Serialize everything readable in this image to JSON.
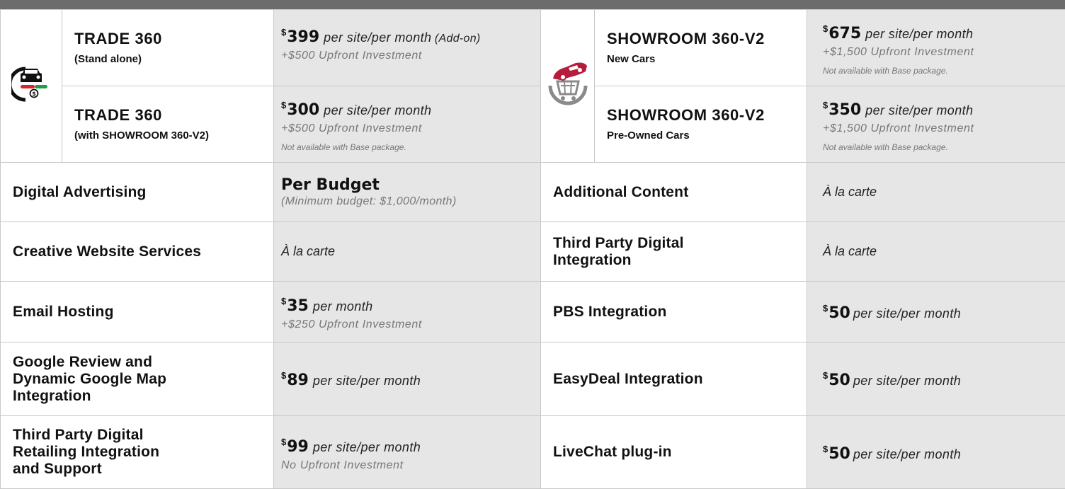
{
  "products": {
    "trade": {
      "icon": "trade-car-icon",
      "rows": [
        {
          "title": "TRADE 360",
          "subtitle": "(Stand alone)",
          "currency": "$",
          "amount": "399",
          "per": "per site/per month",
          "addon": "(Add-on)",
          "upfront": "+$500 Upfront Investment",
          "note": ""
        },
        {
          "title": "TRADE 360",
          "subtitle": "(with SHOWROOM 360-V2)",
          "currency": "$",
          "amount": "300",
          "per": "per site/per month",
          "upfront": "+$500 Upfront Investment",
          "note": "Not available with Base package."
        }
      ]
    },
    "showroom": {
      "icon": "showroom-cart-icon",
      "rows": [
        {
          "title": "SHOWROOM 360-V2",
          "subtitle": "New Cars",
          "currency": "$",
          "amount": "675",
          "per": "per site/per month",
          "upfront": "+$1,500 Upfront Investment",
          "note": "Not available with Base package."
        },
        {
          "title": "SHOWROOM 360-V2",
          "subtitle": "Pre-Owned Cars",
          "currency": "$",
          "amount": "350",
          "per": "per site/per month",
          "upfront": "+$1,500 Upfront Investment",
          "note": "Not available with Base package."
        }
      ]
    }
  },
  "services": {
    "digital_advertising": {
      "name": "Digital Advertising",
      "price": "Per Budget",
      "note": "(Minimum budget: $1,000/month)"
    },
    "additional_content": {
      "name": "Additional Content",
      "price": "À la carte"
    },
    "creative_website": {
      "name": "Creative Website Services",
      "price": "À la carte"
    },
    "third_party_integration": {
      "name": "Third Party Digital Integration",
      "price": "À la carte"
    },
    "email_hosting": {
      "name": "Email Hosting",
      "currency": "$",
      "amount": "35",
      "per": "per month",
      "upfront": "+$250 Upfront Investment"
    },
    "pbs_integration": {
      "name": "PBS Integration",
      "currency": "$",
      "amount": "50",
      "per": "per site/per month"
    },
    "google_review": {
      "name_lines": [
        "Google Review and",
        "Dynamic Google Map",
        "Integration"
      ],
      "currency": "$",
      "amount": "89",
      "per": "per site/per month"
    },
    "easydeal_integration": {
      "name": "EasyDeal Integration",
      "currency": "$",
      "amount": "50",
      "per": "per site/per month"
    },
    "third_party_retailing": {
      "name_lines": [
        "Third Party Digital",
        "Retailing Integration",
        "and Support"
      ],
      "currency": "$",
      "amount": "99",
      "per": "per site/per month",
      "upfront": "No Upfront Investment"
    },
    "livechat": {
      "name": "LiveChat plug-in",
      "currency": "$",
      "amount": "50",
      "per": "per site/per month"
    }
  },
  "colors": {
    "header_bar": "#6c6c6c",
    "price_cell_bg": "#e6e6e6",
    "grid_line": "#c9c9c9",
    "trade_icon_green": "#1e9e4a",
    "trade_icon_red": "#d9262c",
    "showroom_icon_red": "#b71c3c",
    "showroom_icon_gray": "#8a8a8a"
  }
}
